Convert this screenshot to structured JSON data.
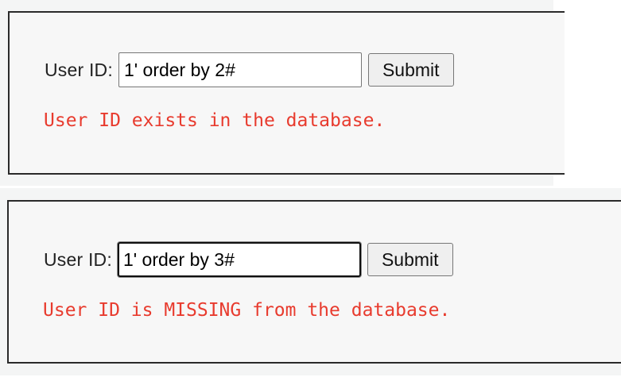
{
  "screens": [
    {
      "user_id_label": "User ID:",
      "input_value": "1' order by 2#",
      "submit_label": "Submit",
      "result_message": "User ID exists in the database."
    },
    {
      "user_id_label": "User ID:",
      "input_value": "1' order by 3#",
      "submit_label": "Submit",
      "result_message": "User ID is MISSING from the database."
    }
  ],
  "colors": {
    "message_text": "#e83b2e",
    "panel_border": "#2a2a2a",
    "panel_background": "#f7f7f7"
  }
}
